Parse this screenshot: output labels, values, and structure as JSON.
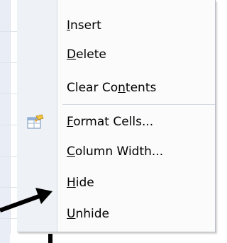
{
  "menu": {
    "items": [
      {
        "id": "insert",
        "prefix": "",
        "mnemonic": "I",
        "suffix": "nsert",
        "icon": null
      },
      {
        "id": "delete",
        "prefix": "",
        "mnemonic": "D",
        "suffix": "elete",
        "icon": null
      },
      {
        "id": "clear-contents",
        "prefix": "Clear Co",
        "mnemonic": "n",
        "suffix": "tents",
        "icon": null
      },
      {
        "id": "format-cells",
        "prefix": "",
        "mnemonic": "F",
        "suffix": "ormat Cells...",
        "icon": "format-cells-icon"
      },
      {
        "id": "column-width",
        "prefix": "",
        "mnemonic": "C",
        "suffix": "olumn Width...",
        "icon": null
      },
      {
        "id": "hide",
        "prefix": "",
        "mnemonic": "H",
        "suffix": "ide",
        "icon": null
      },
      {
        "id": "unhide",
        "prefix": "",
        "mnemonic": "U",
        "suffix": "nhide",
        "icon": null
      }
    ]
  },
  "annotation": {
    "arrow_icon": "arrow-right-icon",
    "arrow_color": "#000000",
    "points_to": "hide"
  },
  "colors": {
    "menu_background": "#fbfbfb",
    "gutter": "#eef1f5",
    "text": "#000000"
  }
}
